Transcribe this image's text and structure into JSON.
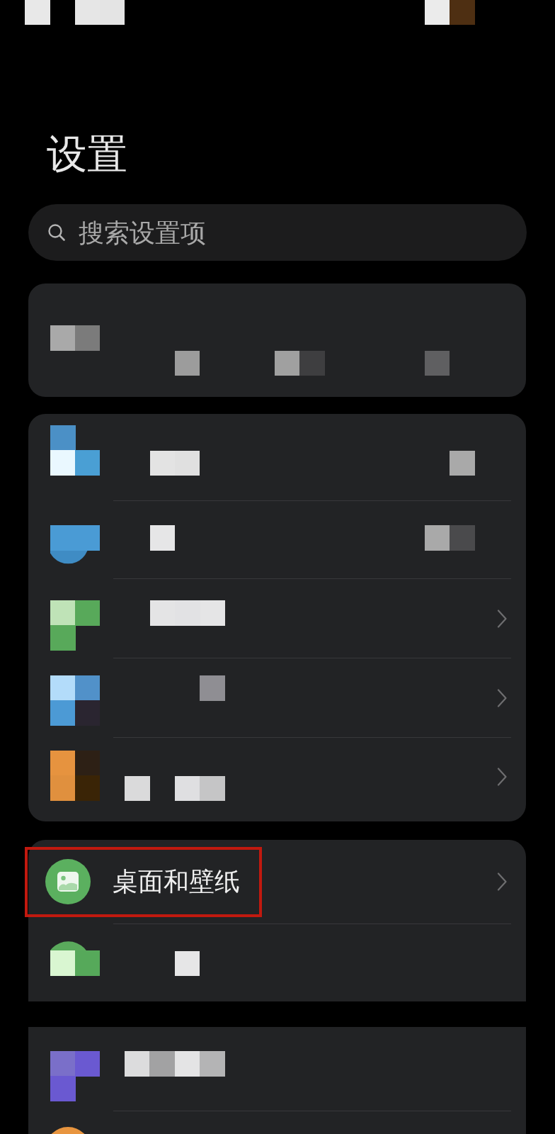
{
  "status_bar": {
    "kind": "pixelated"
  },
  "title": "设置",
  "search": {
    "placeholder": "搜索设置项"
  },
  "groups": [
    {
      "rows": [
        {
          "kind": "pixelated",
          "chevron": false
        }
      ]
    },
    {
      "rows": [
        {
          "kind": "pixelated",
          "chevron": false
        },
        {
          "kind": "pixelated",
          "chevron": false
        },
        {
          "kind": "pixelated",
          "chevron": true
        },
        {
          "kind": "pixelated",
          "chevron": true
        },
        {
          "kind": "pixelated",
          "chevron": true
        }
      ]
    },
    {
      "rows": [
        {
          "kind": "item",
          "label": "桌面和壁纸",
          "chevron": true,
          "highlighted": true
        },
        {
          "kind": "pixelated",
          "chevron": false
        }
      ]
    },
    {
      "rows": [
        {
          "kind": "pixelated",
          "chevron": false
        },
        {
          "kind": "pixelated",
          "chevron": false
        }
      ]
    }
  ]
}
